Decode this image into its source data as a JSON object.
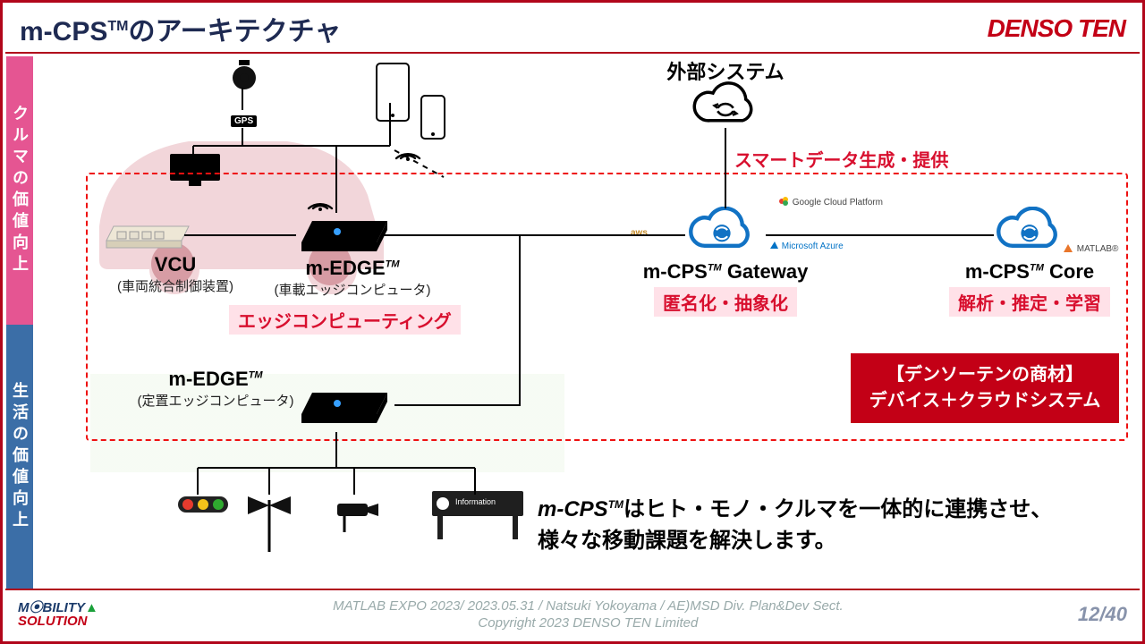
{
  "header": {
    "title_prefix": "m-CPS",
    "title_tm": "TM",
    "title_suffix": "のアーキテクチャ",
    "brand": "DENSO TEN"
  },
  "sidetabs": {
    "top": "クルマの価値向上",
    "bottom": "生活の価値向上"
  },
  "nodes": {
    "external_system": "外部システム",
    "smart_data": "スマートデータ生成・提供",
    "vcu_title": "VCU",
    "vcu_sub": "(車両統合制御装置)",
    "medge_car_title": "m-EDGE",
    "medge_car_tm": "TM",
    "medge_car_sub": "(車載エッジコンピュータ)",
    "edge_computing": "エッジコンピューティング",
    "gateway_title_prefix": "m-CPS",
    "gateway_tm": "TM",
    "gateway_title_suffix": " Gateway",
    "gateway_tag": "匿名化・抽象化",
    "core_title_prefix": "m-CPS",
    "core_tm": "TM",
    "core_title_suffix": " Core",
    "core_tag": "解析・推定・学習",
    "medge_fixed_title": "m-EDGE",
    "medge_fixed_tm": "TM",
    "medge_fixed_sub": "(定置エッジコンピュータ)",
    "cloud_aws": "aws",
    "cloud_gcp": "Google Cloud Platform",
    "cloud_azure": "Microsoft Azure",
    "cloud_matlab": "MATLAB®",
    "gps": "GPS",
    "info_sign": "Information"
  },
  "product_box": {
    "line1": "【デンソーテンの商材】",
    "line2": "デバイス＋クラウドシステム"
  },
  "summary": {
    "prefix": "m-CPS",
    "tm": "TM",
    "line1_rest": "はヒト・モノ・クルマを一体的に連携させ、",
    "line2": "様々な移動課題を解決します。"
  },
  "footer": {
    "mobility_line1": "M⦿BILITY",
    "mobility_line2": "SOLUTION",
    "center_line1": "MATLAB EXPO 2023/ 2023.05.31 / Natsuki Yokoyama / AE)MSD Div. Plan&Dev Sect.",
    "center_line2": "Copyright 2023 DENSO TEN Limited",
    "page_current": "12",
    "page_total": "40"
  }
}
